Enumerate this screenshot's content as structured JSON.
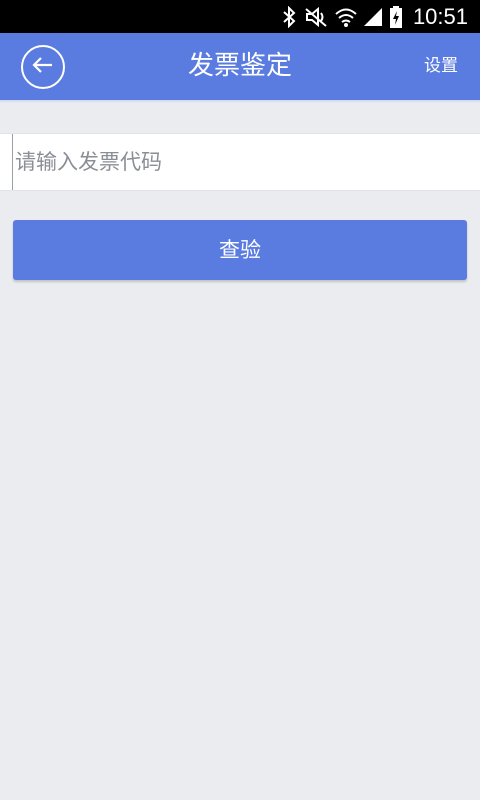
{
  "status_bar": {
    "time": "10:51",
    "icons": [
      "bluetooth-icon",
      "mute-icon",
      "wifi-icon",
      "signal-icon",
      "battery-charging-icon"
    ]
  },
  "app_bar": {
    "back_icon": "arrow-left-icon",
    "title": "发票鉴定",
    "settings_label": "设置",
    "color": "#5a7be0"
  },
  "form": {
    "input_value": "",
    "input_placeholder": "请输入发票代码",
    "submit_label": "查验"
  },
  "colors": {
    "accent": "#5a7be0",
    "background": "#eaecf0"
  }
}
